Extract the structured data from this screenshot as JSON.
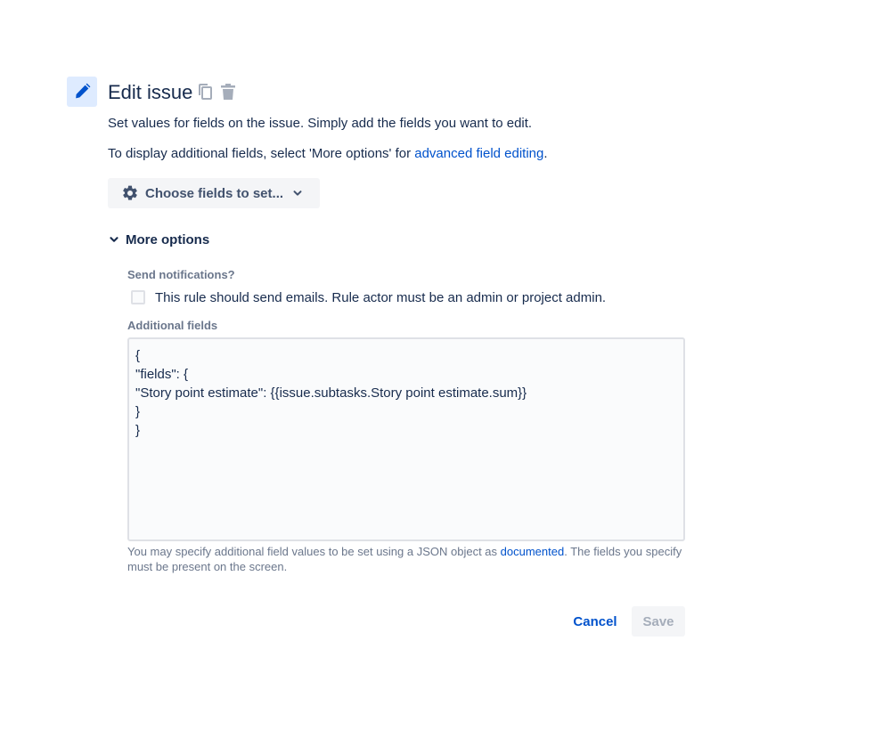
{
  "header": {
    "title": "Edit issue",
    "icon": "pencil-icon",
    "actions": [
      {
        "name": "duplicate",
        "icon": "copy-icon"
      },
      {
        "name": "delete",
        "icon": "trash-icon"
      }
    ]
  },
  "description": {
    "line1": "Set values for fields on the issue. Simply add the fields you want to edit.",
    "line2_prefix": "To display additional fields, select 'More options' for ",
    "line2_link": "advanced field editing",
    "line2_suffix": "."
  },
  "choose_fields": {
    "label": "Choose fields to set...",
    "icon": "gear-icon"
  },
  "more_options": {
    "label": "More options",
    "expanded": true
  },
  "notifications": {
    "label": "Send notifications?",
    "checkbox_label": "This rule should send emails. Rule actor must be an admin or project admin.",
    "checked": false
  },
  "additional_fields": {
    "label": "Additional fields",
    "value": "{\n\"fields\": {\n\"Story point estimate\": {{issue.subtasks.Story point estimate.sum}}\n}\n}",
    "help_prefix": "You may specify additional field values to be set using a JSON object as ",
    "help_link": "documented",
    "help_suffix": ". The fields you specify must be present on the screen."
  },
  "footer": {
    "cancel_label": "Cancel",
    "save_label": "Save",
    "save_disabled": true
  },
  "colors": {
    "link": "#0052cc",
    "text": "#172b4d",
    "subtle": "#6b778c",
    "icon_bg": "#deebff"
  }
}
